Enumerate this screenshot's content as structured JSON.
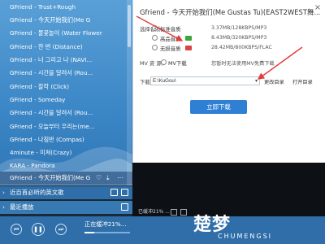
{
  "playlist": {
    "items": [
      {
        "label": "GFriend - Trust+Rough"
      },
      {
        "label": "GFriend - 今天开始我们(Me G"
      },
      {
        "label": "GFriend - 물꽃놀이 (Water Flower"
      },
      {
        "label": "GFriend - 한 번 (Distance)"
      },
      {
        "label": "GFriend - 너 그리고 나 (NAVI..."
      },
      {
        "label": "GFriend - 시간을 달려서 (Rou..."
      },
      {
        "label": "GFriend - 찰칵 (Click)"
      },
      {
        "label": "GFriend - Someday"
      },
      {
        "label": "GFriend - 시간을 달려서 (Rou..."
      },
      {
        "label": "GFriend - 오늘부터 우리는(me..."
      },
      {
        "label": "GFriend - 나침반 (Compas)"
      },
      {
        "label": "4minute - 미쳐(Crazy)"
      },
      {
        "label": "KARA - Pandora"
      },
      {
        "label": "GFriend - 今天开始我们(Me G"
      }
    ],
    "sections": [
      {
        "label": "近百首必听的英文歌"
      },
      {
        "label": "最近播放"
      }
    ]
  },
  "player": {
    "now_playing": "正在缓冲21%...",
    "progress": 0.21,
    "video_status": "已缓冲21% ..."
  },
  "dialog": {
    "title": "Gfriend - 今天开始我们(Me Gustas Tu)(EAST2WEST舞...",
    "quality_label": "选择音质：",
    "options": [
      {
        "name": "标准音质",
        "size": "3.37MB/128KBPS/MP3",
        "badge_color": "",
        "selected": true
      },
      {
        "name": "高品音质",
        "size": "8.43MB/320KBPS/MP3",
        "badge_color": "#3aa63a",
        "selected": false
      },
      {
        "name": "无损音质",
        "size": "28.42MB/800KBPS/FLAC",
        "badge_color": "#d94444",
        "selected": false
      }
    ],
    "mv_label": "MV 资 源：",
    "mv_option": "MV下载",
    "mv_note": "您暂时无法使用MV免费下载",
    "path_label": "下载地址：",
    "path_value": "E:\\KuGou\\",
    "change_dir": "更改目录",
    "open_dir": "打开目录",
    "download_button": "立即下载"
  },
  "watermark": {
    "logo": "楚梦",
    "sub": "CHUMENGSI"
  }
}
